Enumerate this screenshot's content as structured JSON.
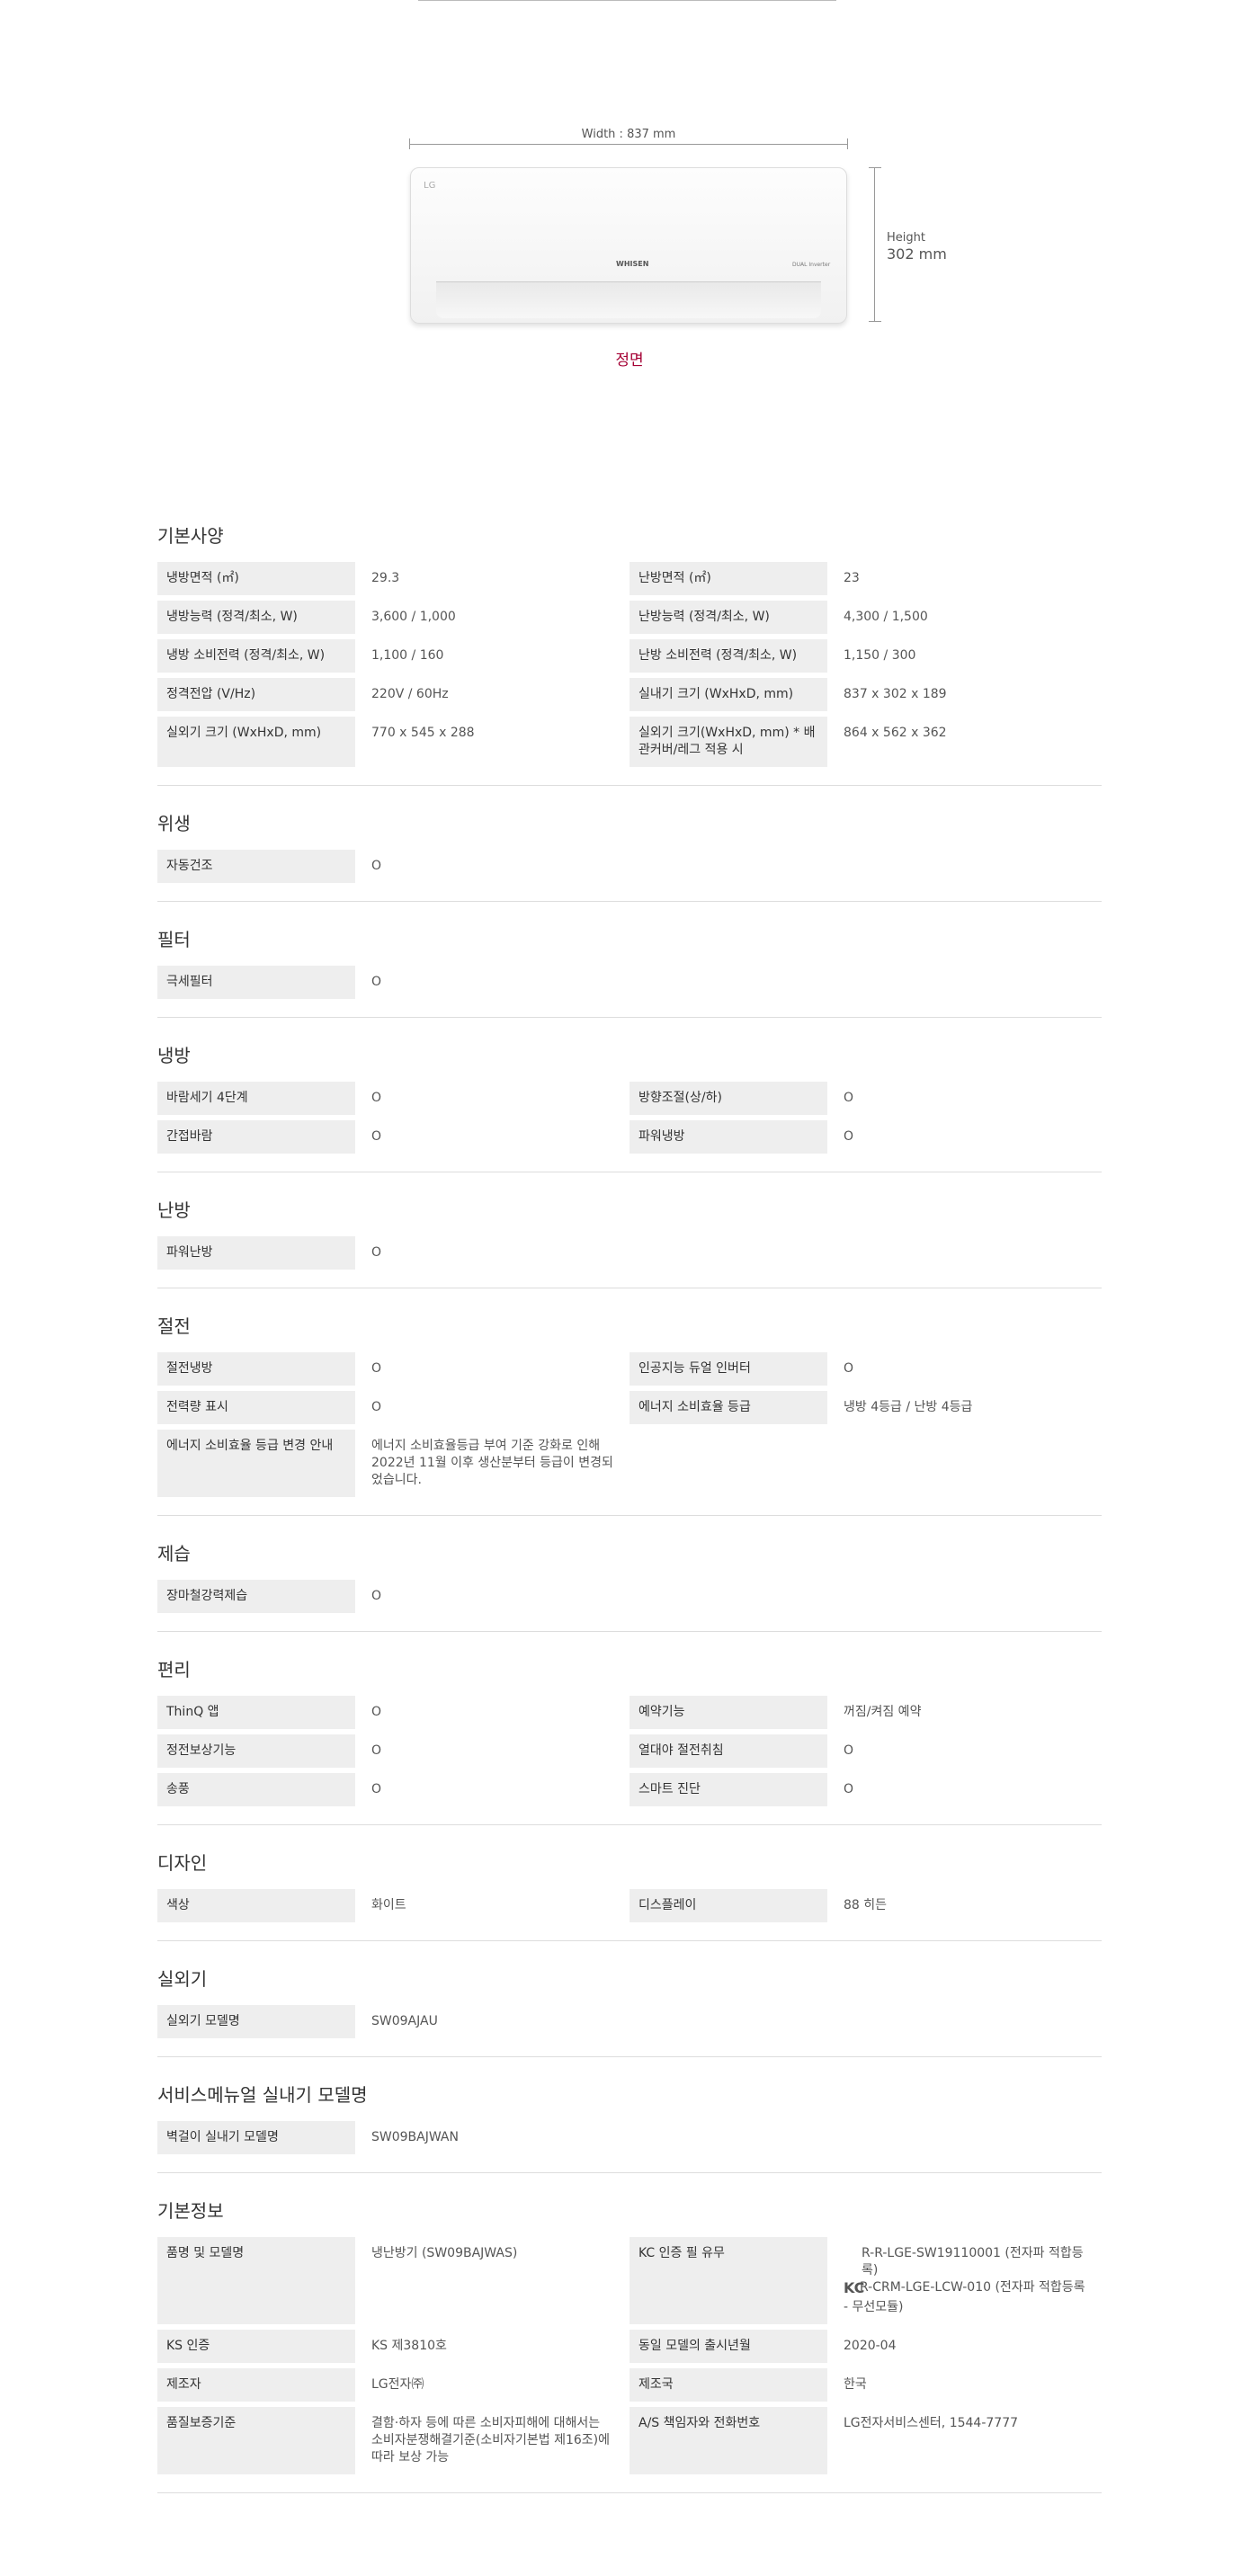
{
  "figure": {
    "width_label": "Width : 837 mm",
    "height_label_1": "Height",
    "height_label_2": "302 mm",
    "logo": "LG",
    "brand": "WHISEN",
    "inverter": "DUAL Inverter",
    "view_label": "정면"
  },
  "sections": {
    "basic_spec": {
      "title": "기본사양",
      "rows": [
        {
          "k1": "냉방면적 (㎡)",
          "v1": "29.3",
          "k2": "난방면적 (㎡)",
          "v2": "23"
        },
        {
          "k1": "냉방능력 (정격/최소, W)",
          "v1": "3,600 / 1,000",
          "k2": "난방능력 (정격/최소, W)",
          "v2": "4,300 / 1,500"
        },
        {
          "k1": "냉방 소비전력 (정격/최소, W)",
          "v1": "1,100 / 160",
          "k2": "난방 소비전력 (정격/최소, W)",
          "v2": "1,150 / 300"
        },
        {
          "k1": "정격전압 (V/Hz)",
          "v1": "220V / 60Hz",
          "k2": "실내기 크기 (WxHxD, mm)",
          "v2": "837 x 302 x 189"
        },
        {
          "k1": "실외기 크기 (WxHxD, mm)",
          "v1": "770 x 545 x 288",
          "k2": "실외기 크기(WxHxD, mm) * 배관커버/레그 적용 시",
          "v2": "864 x 562 x 362"
        }
      ]
    },
    "hygiene": {
      "title": "위생",
      "rows": [
        {
          "k1": "자동건조",
          "v1": "O"
        }
      ]
    },
    "filter": {
      "title": "필터",
      "rows": [
        {
          "k1": "극세필터",
          "v1": "O"
        }
      ]
    },
    "cooling": {
      "title": "냉방",
      "rows": [
        {
          "k1": "바람세기 4단계",
          "v1": "O",
          "k2": "방향조절(상/하)",
          "v2": "O"
        },
        {
          "k1": "간접바람",
          "v1": "O",
          "k2": "파워냉방",
          "v2": "O"
        }
      ]
    },
    "heating": {
      "title": "난방",
      "rows": [
        {
          "k1": "파워난방",
          "v1": "O"
        }
      ]
    },
    "power_saving": {
      "title": "절전",
      "rows": [
        {
          "k1": "절전냉방",
          "v1": "O",
          "k2": "인공지능 듀얼 인버터",
          "v2": "O"
        },
        {
          "k1": "전력량 표시",
          "v1": "O",
          "k2": "에너지 소비효율 등급",
          "v2": "냉방 4등급 / 난방 4등급"
        },
        {
          "k1": "에너지 소비효율 등급 변경 안내",
          "v1": "에너지 소비효율등급 부여 기준 강화로 인해 2022년 11월 이후 생산분부터 등급이 변경되었습니다."
        }
      ]
    },
    "dehumid": {
      "title": "제습",
      "rows": [
        {
          "k1": "장마철강력제습",
          "v1": "O"
        }
      ]
    },
    "convenience": {
      "title": "편리",
      "rows": [
        {
          "k1": "ThinQ 앱",
          "v1": "O",
          "k2": "예약기능",
          "v2": "꺼짐/켜짐 예약"
        },
        {
          "k1": "정전보상기능",
          "v1": "O",
          "k2": "열대야 절전취침",
          "v2": "O"
        },
        {
          "k1": "송풍",
          "v1": "O",
          "k2": "스마트 진단",
          "v2": "O"
        }
      ]
    },
    "design": {
      "title": "디자인",
      "rows": [
        {
          "k1": "색상",
          "v1": "화이트",
          "k2": "디스플레이",
          "v2": "88 히든"
        }
      ]
    },
    "outdoor": {
      "title": "실외기",
      "rows": [
        {
          "k1": "실외기 모델명",
          "v1": "SW09AJAU"
        }
      ]
    },
    "service_manual": {
      "title": "서비스메뉴얼 실내기 모델명",
      "rows": [
        {
          "k1": "벽걸이 실내기 모델명",
          "v1": "SW09BAJWAN"
        }
      ]
    },
    "basic_info": {
      "title": "기본정보",
      "row1": {
        "k1": "품명 및 모델명",
        "v1": "냉난방기 (SW09BAJWAS)",
        "k2": "KC 인증 필 유무",
        "kc_icon": "KC",
        "kc_line1": "R-R-LGE-SW19110001 (전자파 적합등록)",
        "kc_line2": "R-CRM-LGE-LCW-010 (전자파 적합등록 - 무선모듈)"
      },
      "rows": [
        {
          "k1": "KS 인증",
          "v1": "KS 제3810호",
          "k2": "동일 모델의 출시년월",
          "v2": "2020-04"
        },
        {
          "k1": "제조자",
          "v1": "LG전자㈜",
          "k2": "제조국",
          "v2": "한국"
        },
        {
          "k1": "품질보증기준",
          "v1": "결함·하자 등에 따른 소비자피해에 대해서는 소비자분쟁해결기준(소비자기본법 제16조)에 따라 보상 가능",
          "k2": "A/S 책임자와 전화번호",
          "v2": "LG전자서비스센터, 1544-7777"
        }
      ]
    }
  }
}
